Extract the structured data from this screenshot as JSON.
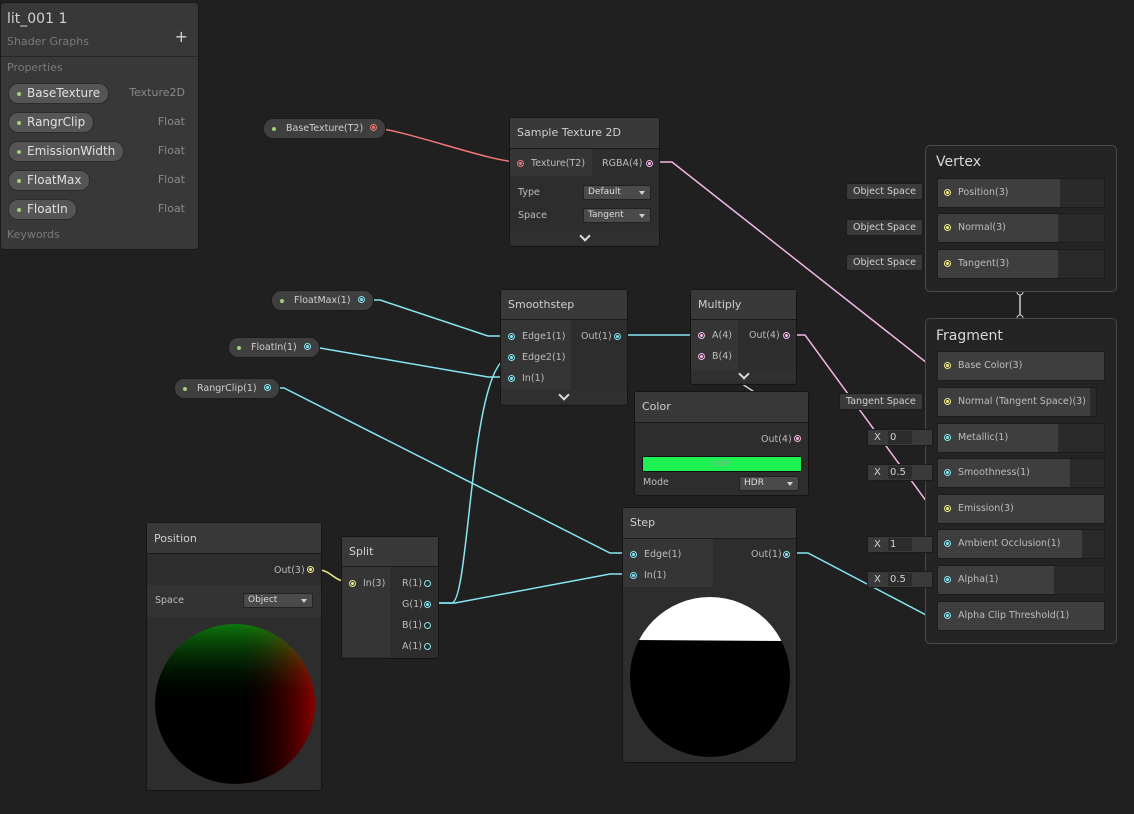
{
  "blackboard": {
    "title": "lit_001 1",
    "subtitle": "Shader Graphs",
    "add_label": "+",
    "properties_label": "Properties",
    "keywords_label": "Keywords",
    "properties": [
      {
        "name": "BaseTexture",
        "type": "Texture2D"
      },
      {
        "name": "RangrClip",
        "type": "Float"
      },
      {
        "name": "EmissionWidth",
        "type": "Float"
      },
      {
        "name": "FloatMax",
        "type": "Float"
      },
      {
        "name": "FloatIn",
        "type": "Float"
      }
    ]
  },
  "property_nodes": {
    "base_texture": "BaseTexture(T2)",
    "float_max": "FloatMax(1)",
    "float_in": "FloatIn(1)",
    "rangr_clip": "RangrClip(1)"
  },
  "sample_texture": {
    "title": "Sample Texture 2D",
    "in_texture": "Texture(T2)",
    "out_rgba": "RGBA(4)",
    "type_label": "Type",
    "type_value": "Default",
    "space_label": "Space",
    "space_value": "Tangent"
  },
  "smoothstep": {
    "title": "Smoothstep",
    "in_edge1": "Edge1(1)",
    "in_edge2": "Edge2(1)",
    "in_in": "In(1)",
    "out": "Out(1)"
  },
  "multiply": {
    "title": "Multiply",
    "in_a": "A(4)",
    "in_b": "B(4)",
    "out": "Out(4)"
  },
  "color": {
    "title": "Color",
    "out": "Out(4)",
    "hdr_label": "HDR",
    "mode_label": "Mode",
    "mode_value": "HDR",
    "swatch": "#1ef253"
  },
  "step": {
    "title": "Step",
    "in_edge": "Edge(1)",
    "in_in": "In(1)",
    "out": "Out(1)"
  },
  "position": {
    "title": "Position",
    "out": "Out(3)",
    "space_label": "Space",
    "space_value": "Object"
  },
  "split": {
    "title": "Split",
    "in": "In(3)",
    "out_r": "R(1)",
    "out_g": "G(1)",
    "out_b": "B(1)",
    "out_a": "A(1)"
  },
  "vertex": {
    "title": "Vertex",
    "blocks": [
      {
        "label": "Position(3)",
        "tag": "Object Space"
      },
      {
        "label": "Normal(3)",
        "tag": "Object Space"
      },
      {
        "label": "Tangent(3)",
        "tag": "Object Space"
      }
    ]
  },
  "fragment": {
    "title": "Fragment",
    "blocks": [
      {
        "label": "Base Color(3)"
      },
      {
        "label": "Normal (Tangent Space)(3)",
        "tag": "Tangent Space"
      },
      {
        "label": "Metallic(1)",
        "x": "X",
        "value": "0"
      },
      {
        "label": "Smoothness(1)",
        "x": "X",
        "value": "0.5"
      },
      {
        "label": "Emission(3)"
      },
      {
        "label": "Ambient Occlusion(1)",
        "x": "X",
        "value": "1"
      },
      {
        "label": "Alpha(1)",
        "x": "X",
        "value": "0.5"
      },
      {
        "label": "Alpha Clip Threshold(1)"
      }
    ]
  },
  "colors": {
    "float_wire": "#86e6f2",
    "vector3_wire": "#f2ec86",
    "vector4_wire": "#f2b6e6",
    "texture_wire": "#f27878",
    "background": "#202020"
  }
}
